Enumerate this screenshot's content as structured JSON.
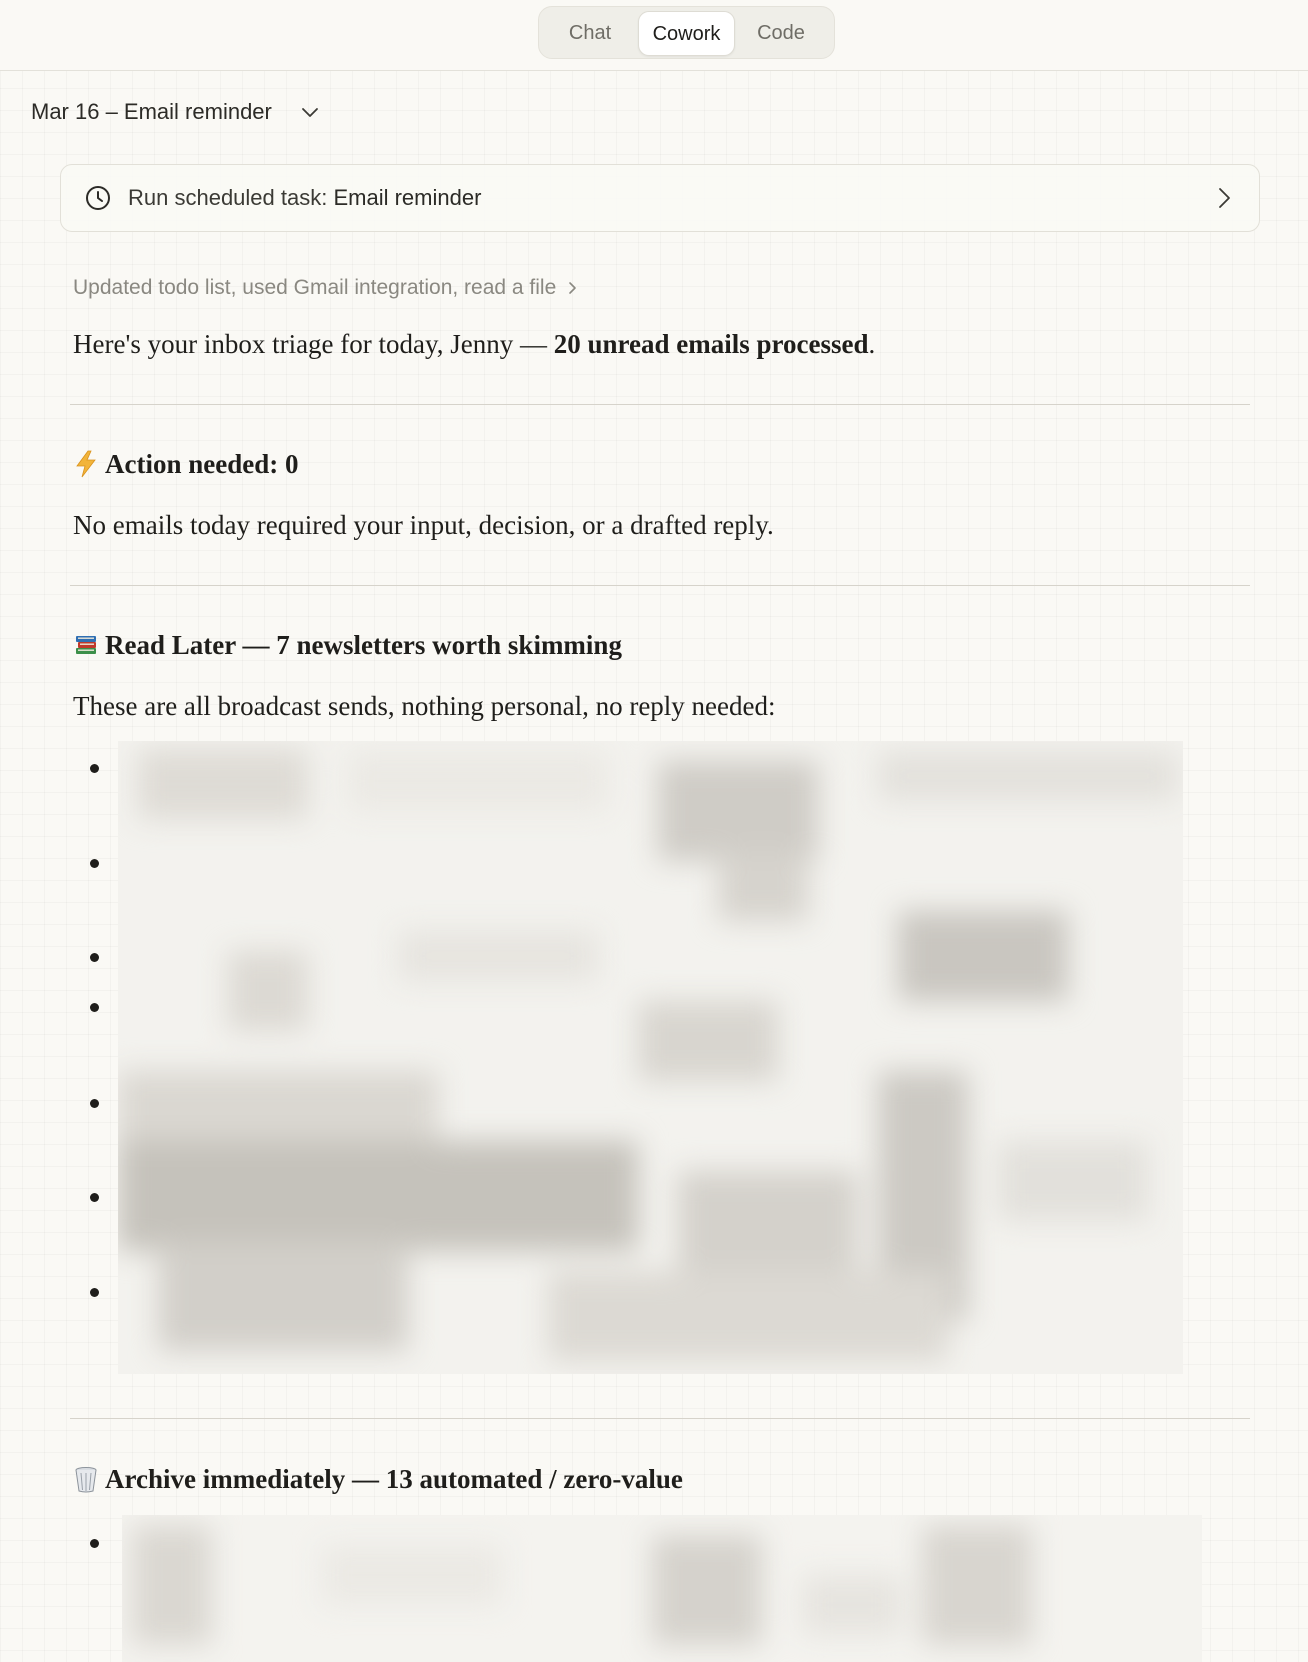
{
  "mode_tabs": [
    {
      "label": "Chat",
      "active": false
    },
    {
      "label": "Cowork",
      "active": true
    },
    {
      "label": "Code",
      "active": false
    }
  ],
  "conversation": {
    "title": "Mar 16 – Email reminder",
    "dropdown_icon": "chevron-down-icon"
  },
  "task_card": {
    "icon": "clock-icon",
    "prefix": "Run scheduled task: ",
    "task_name": "Email reminder",
    "chevron_icon": "chevron-right-icon"
  },
  "tool_summary": {
    "label": "Updated todo list, used Gmail integration, read a file",
    "chevron_icon": "chevron-right-icon"
  },
  "message": {
    "intro_plain": "Here's your inbox triage for today, Jenny — ",
    "intro_bold": "20 unread emails processed",
    "intro_end": ".",
    "sections": [
      {
        "emoji": "⚡",
        "icon": "lightning-icon",
        "title": "Action needed: 0",
        "text": "No emails today required your input, decision, or a drafted reply."
      },
      {
        "emoji": "📚",
        "icon": "books-icon",
        "title": "Read Later — 7 newsletters worth skimming",
        "text": "These are all broadcast sends, nothing personal, no reply needed:",
        "list_item_count": 7
      },
      {
        "emoji": "🗑",
        "icon": "wastebasket-icon",
        "title": "Archive immediately — 13 automated / zero-value"
      }
    ]
  },
  "colors": {
    "background": "#faf9f5",
    "text": "#1f1e1b",
    "muted_text": "#8a8881",
    "divider": "#d6d3cb",
    "lightning": "#f2b43a"
  }
}
